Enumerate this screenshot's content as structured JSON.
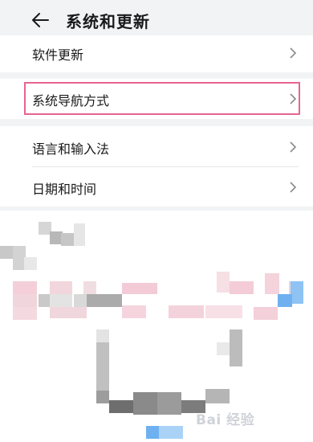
{
  "header": {
    "title": "系统和更新",
    "back_icon": "arrow-left-icon"
  },
  "settings": {
    "items": [
      {
        "label": "软件更新",
        "icon": "chevron-right-icon"
      },
      {
        "label": "系统导航方式",
        "icon": "chevron-right-icon",
        "highlighted": true
      },
      {
        "label": "语言和输入法",
        "icon": "chevron-right-icon"
      },
      {
        "label": "日期和时间",
        "icon": "chevron-right-icon"
      }
    ]
  },
  "watermark": {
    "text": "Bai 经验"
  },
  "colors": {
    "background": "#f1f3f5",
    "highlight": "#e8648f",
    "accent": "#6fb1f0"
  }
}
